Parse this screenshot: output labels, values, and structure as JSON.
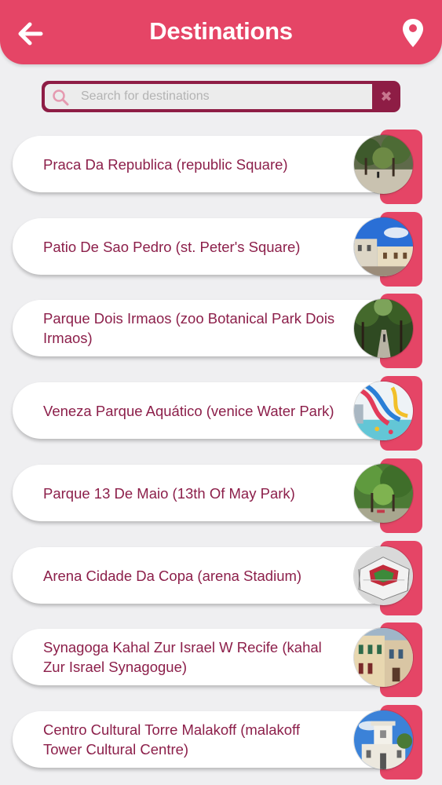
{
  "header": {
    "title": "Destinations",
    "background": "#e54566",
    "back_icon": "arrow-left-icon",
    "location_icon": "map-pin-icon"
  },
  "search": {
    "placeholder": "Search for destinations",
    "value": "",
    "accent": "#8e1d45",
    "clear_label": "✖"
  },
  "destinations": [
    {
      "name": "Praca Da Republica (republic Square)",
      "image": "square-trees-photo"
    },
    {
      "name": "Patio De Sao Pedro (st. Peter's Square)",
      "image": "colonial-church-photo"
    },
    {
      "name": "Parque Dois Irmaos (zoo Botanical Park Dois Irmaos)",
      "image": "forest-path-photo"
    },
    {
      "name": "Veneza Parque Aquático (venice Water Park)",
      "image": "water-slides-photo"
    },
    {
      "name": "Parque 13 De Maio (13th Of May Park)",
      "image": "park-trees-photo"
    },
    {
      "name": "Arena Cidade Da Copa (arena Stadium)",
      "image": "stadium-aerial-photo"
    },
    {
      "name": "Synagoga Kahal Zur Israel W Recife (kahal Zur Israel Synagogue)",
      "image": "synagogue-facade-photo"
    },
    {
      "name": "Centro Cultural Torre Malakoff (malakoff Tower Cultural Centre)",
      "image": "white-tower-photo"
    }
  ],
  "colors": {
    "item_text": "#8c1f4a",
    "tab": "#e54566",
    "page_bg": "#efeff1"
  }
}
